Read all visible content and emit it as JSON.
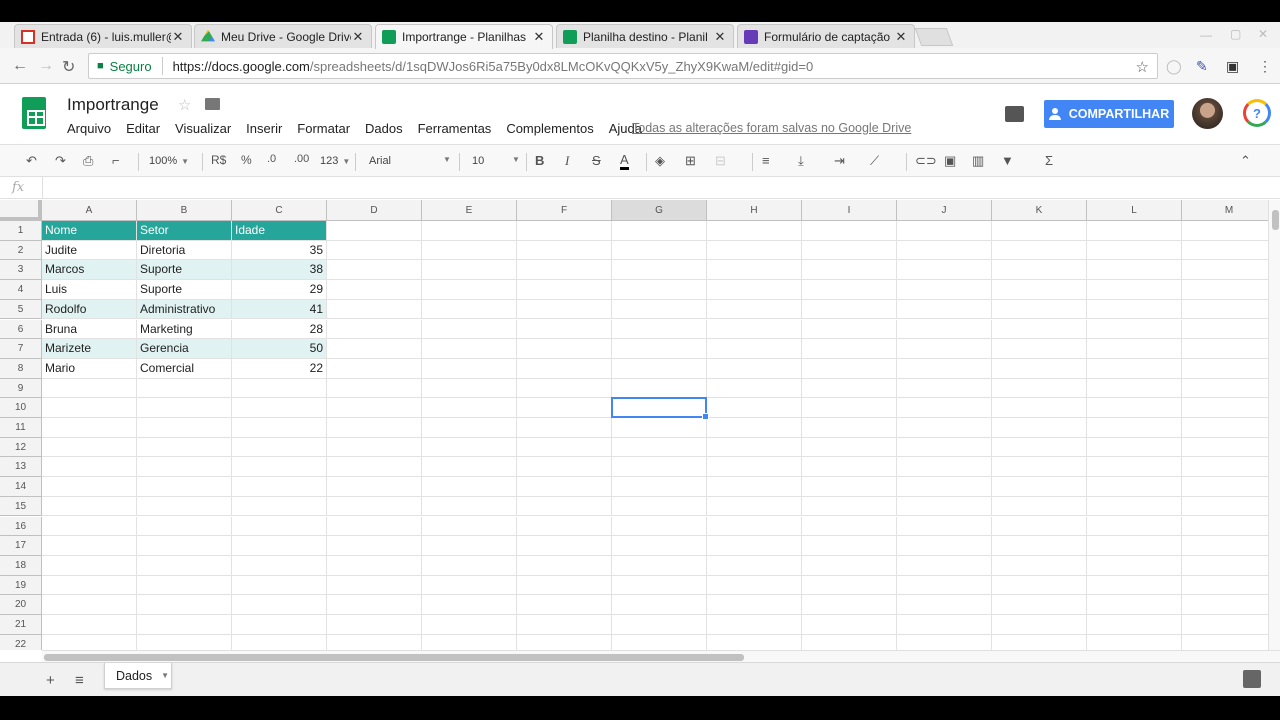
{
  "browser": {
    "tabs": [
      {
        "title": "Entrada (6) - luis.muller@",
        "icon": "gmail-icon"
      },
      {
        "title": "Meu Drive - Google Drive",
        "icon": "drive-icon"
      },
      {
        "title": "Importrange - Planilhas",
        "icon": "sheets-icon"
      },
      {
        "title": "Planilha destino - Planil",
        "icon": "sheets-icon"
      },
      {
        "title": "Formulário de captação",
        "icon": "forms-icon"
      }
    ],
    "active_tab": 2,
    "close_glyph": "✕",
    "secure_label": "Seguro",
    "url_host": "https://docs.google.com",
    "url_rest": "/spreadsheets/d/1sqDWJos6Ri5a75By0dx8LMcOKvQQKxV5y_ZhyX9KwaM/edit#gid=0"
  },
  "app": {
    "doc_title": "Importrange",
    "menu": [
      "Arquivo",
      "Editar",
      "Visualizar",
      "Inserir",
      "Formatar",
      "Dados",
      "Ferramentas",
      "Complementos",
      "Ajuda"
    ],
    "saved_message": "Todas as alterações foram salvas no Google Drive",
    "share_label": "COMPARTILHAR",
    "help_glyph": "?"
  },
  "toolbar": {
    "zoom": "100%",
    "currency": "R$",
    "percent": "%",
    "dec_decrease": ".0",
    "dec_increase": ".00",
    "more_formats": "123",
    "font": "Arial",
    "font_size": "10",
    "bold": "B",
    "italic": "I",
    "strike": "S",
    "text_color": "A",
    "sum": "Σ"
  },
  "formula_bar": {
    "fx_label": "fx",
    "value": ""
  },
  "grid": {
    "columns": [
      "A",
      "B",
      "C",
      "D",
      "E",
      "F",
      "G",
      "H",
      "I",
      "J",
      "K",
      "L",
      "M"
    ],
    "row_numbers": [
      "1",
      "2",
      "3",
      "4",
      "5",
      "6",
      "7",
      "8",
      "9",
      "10",
      "11",
      "12",
      "13",
      "14",
      "15",
      "16",
      "17",
      "18",
      "19",
      "20",
      "21",
      "22"
    ],
    "selected_cell": "G10",
    "headers": [
      "Nome",
      "Setor",
      "Idade"
    ],
    "rows": [
      [
        "Judite",
        "Diretoria",
        "35"
      ],
      [
        "Marcos",
        "Suporte",
        "38"
      ],
      [
        "Luis",
        "Suporte",
        "29"
      ],
      [
        "Rodolfo",
        "Administrativo",
        "41"
      ],
      [
        "Bruna",
        "Marketing",
        "28"
      ],
      [
        "Marizete",
        "Gerencia",
        "50"
      ],
      [
        "Mario",
        "Comercial",
        "22"
      ]
    ],
    "colors": {
      "header_bg": "#26a69a",
      "band_bg": "#e0f2f1",
      "selection": "#4285f4"
    }
  },
  "sheets": {
    "tabs": [
      "Dados"
    ],
    "add_glyph": "+",
    "list_glyph": "≡"
  }
}
